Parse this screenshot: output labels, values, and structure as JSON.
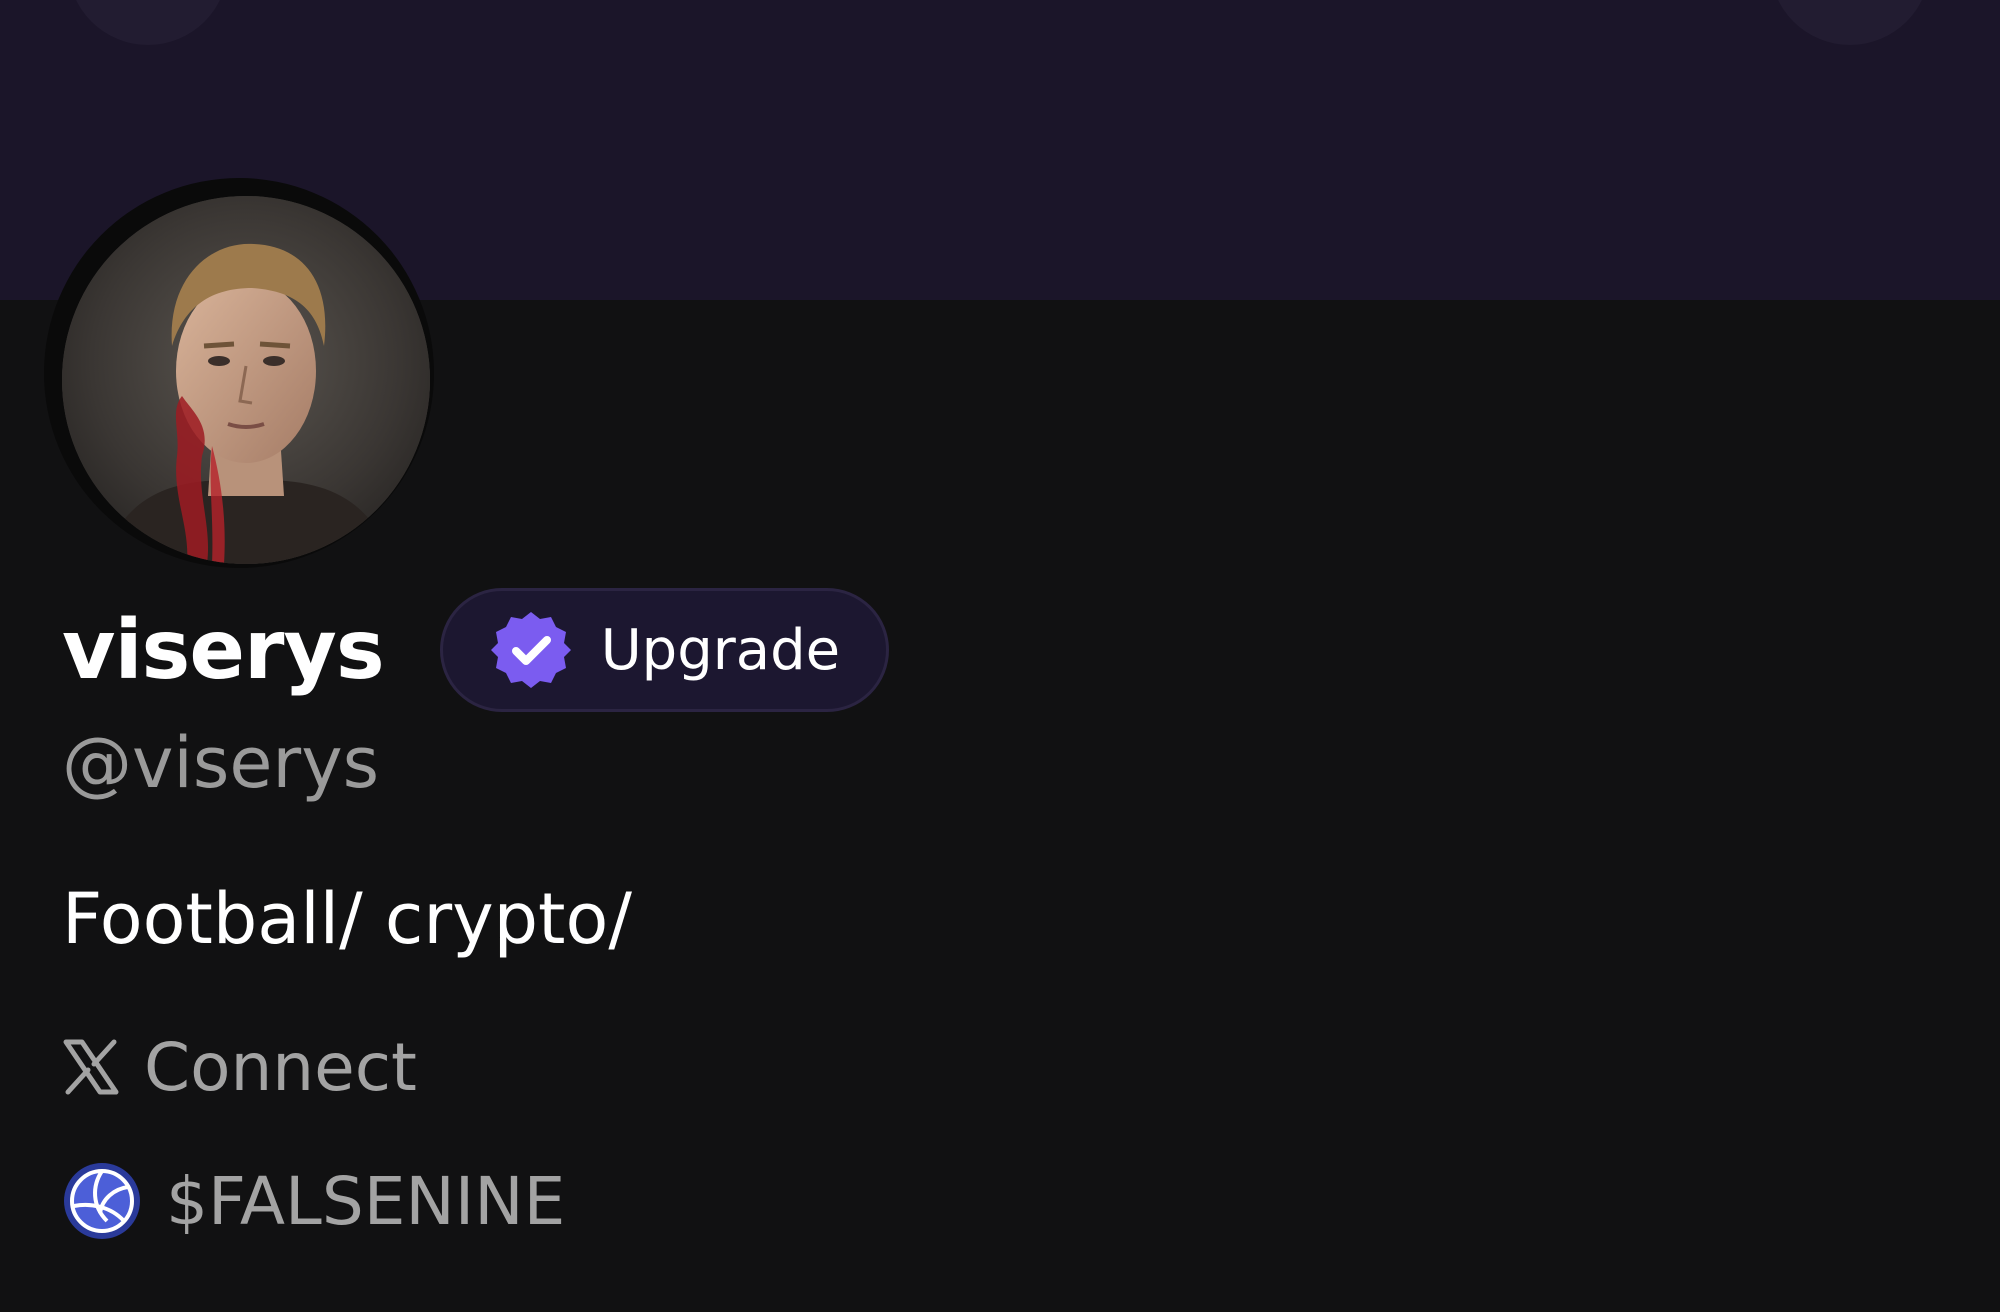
{
  "profile": {
    "display_name": "viserys",
    "handle": "@viserys",
    "bio": "Football/ crypto/",
    "avatar": "profile-photo"
  },
  "upgrade_button": {
    "label": "Upgrade",
    "icon": "verified-badge-icon"
  },
  "links": {
    "x_connect": {
      "icon": "x-logo-icon",
      "label": "Connect"
    },
    "token": {
      "icon": "volleyball-icon",
      "label": "$FALSENINE"
    }
  },
  "colors": {
    "background": "#111112",
    "banner": "#1b1529",
    "accent": "#7b5cf0",
    "secondary_text": "#9a9a9a"
  }
}
